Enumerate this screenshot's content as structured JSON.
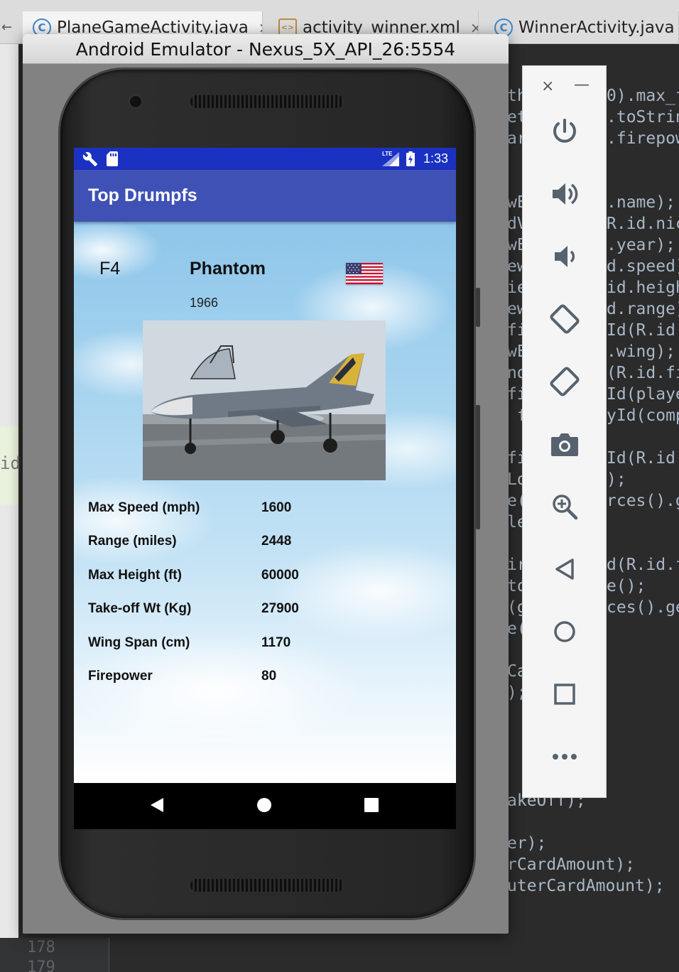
{
  "ide": {
    "tabs": [
      {
        "label": "PlaneGameActivity.java",
        "icon": "C"
      },
      {
        "label": "activity_winner.xml",
        "icon": "<>"
      },
      {
        "label": "WinnerActivity.java",
        "icon": "C"
      }
    ],
    "tab_close": "×",
    "code_right": [
      "0).max_f",
      ".toStrin",
      ".firepow",
      "",
      "",
      ".name);",
      "R.id.nic",
      ".year);",
      "d.speed)",
      "id.heigh",
      "d.range)",
      "Id(R.id.",
      ".wing);",
      "(R.id.fi",
      "Id(playe",
      "yId(comp",
      "",
      "Id(R.id.",
      ");",
      "rces().g",
      "",
      "",
      "d(R.id.f",
      "e();",
      "ces().ge"
    ],
    "code_left": [
      "th",
      "et",
      "ar",
      "",
      "",
      "wE",
      "dV",
      "wE",
      "ew",
      "ie",
      "ew",
      "fi",
      "wE",
      "nd",
      "fi",
      " f",
      "",
      "fi",
      "Lo",
      "e(",
      "le",
      "",
      "ir",
      "to",
      "(g",
      "e(",
      "",
      "Ca",
      ");"
    ],
    "code_bottom": [
      "akeOff);",
      "",
      "er);",
      "rCardAmount);",
      "uterCardAmount);"
    ],
    "gutter_numbers": [
      "178",
      "179"
    ],
    "left_fragment": "id"
  },
  "emulator": {
    "title": "Android Emulator - Nexus_5X_API_26:5554",
    "toolbar": {
      "close_icon": "×",
      "minimize_icon": "—",
      "buttons": [
        "power-icon",
        "volume-up-icon",
        "volume-down-icon",
        "rotate-left-icon",
        "rotate-right-icon",
        "camera-icon",
        "zoom-icon",
        "back-icon",
        "home-icon",
        "overview-icon",
        "more-icon"
      ]
    }
  },
  "statusbar": {
    "time": "1:33",
    "network": "LTE"
  },
  "app": {
    "title": "Top Drumpfs"
  },
  "card": {
    "code": "F4",
    "name": "Phantom",
    "year": "1966",
    "flag": "us-flag",
    "stats": [
      {
        "label": "Max Speed (mph)",
        "value": "1600"
      },
      {
        "label": "Range (miles)",
        "value": "2448"
      },
      {
        "label": "Max Height (ft)",
        "value": "60000"
      },
      {
        "label": "Take-off Wt (Kg)",
        "value": "27900"
      },
      {
        "label": "Wing Span (cm)",
        "value": "1170"
      },
      {
        "label": "Firepower",
        "value": "80"
      }
    ]
  },
  "colors": {
    "statusbar": "#1b31c2",
    "appbar": "#3f51b5"
  }
}
